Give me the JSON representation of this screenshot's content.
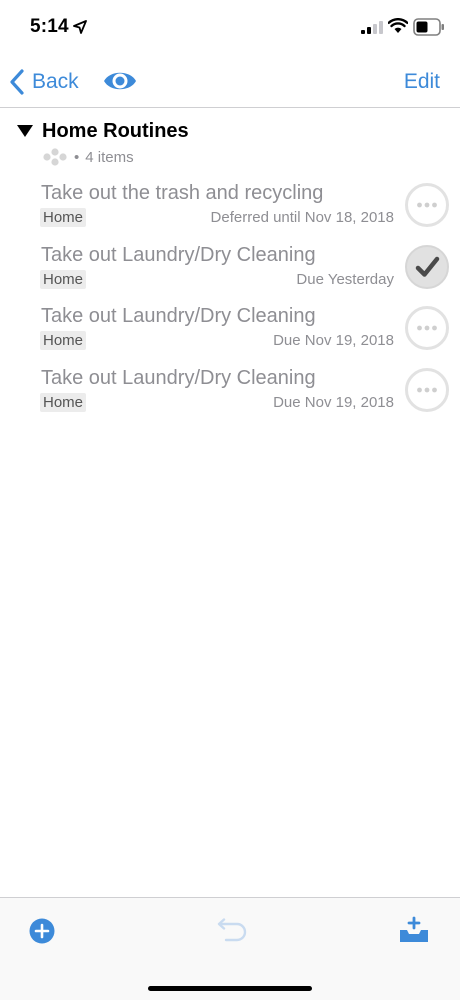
{
  "status_bar": {
    "time": "5:14"
  },
  "nav": {
    "back_label": "Back",
    "edit_label": "Edit"
  },
  "group": {
    "title": "Home Routines",
    "separator": "•",
    "count_text": "4 items"
  },
  "tasks": [
    {
      "title": "Take out the trash and recycling",
      "tag": "Home",
      "meta": "Deferred until Nov 18, 2018",
      "status": "pending"
    },
    {
      "title": "Take out Laundry/Dry Cleaning",
      "tag": "Home",
      "meta": "Due Yesterday",
      "status": "done"
    },
    {
      "title": "Take out Laundry/Dry Cleaning",
      "tag": "Home",
      "meta": "Due Nov 19, 2018",
      "status": "pending"
    },
    {
      "title": "Take out Laundry/Dry Cleaning",
      "tag": "Home",
      "meta": "Due Nov 19, 2018",
      "status": "pending"
    }
  ],
  "icons": {
    "location": "location-arrow-icon",
    "signal": "cellular-signal-icon",
    "wifi": "wifi-icon",
    "battery": "battery-icon",
    "back": "chevron-left-icon",
    "eye": "eye-icon",
    "disclosure": "disclosure-triangle-icon",
    "group_dots": "tag-dots-icon",
    "pending": "ellipsis-circle-icon",
    "done": "checkmark-circle-icon",
    "add": "add-circle-icon",
    "undo": "undo-icon",
    "inbox": "inbox-add-icon"
  },
  "colors": {
    "accent": "#3d8ad9",
    "muted_text": "#8e8e93",
    "tag_bg": "#ececec"
  }
}
